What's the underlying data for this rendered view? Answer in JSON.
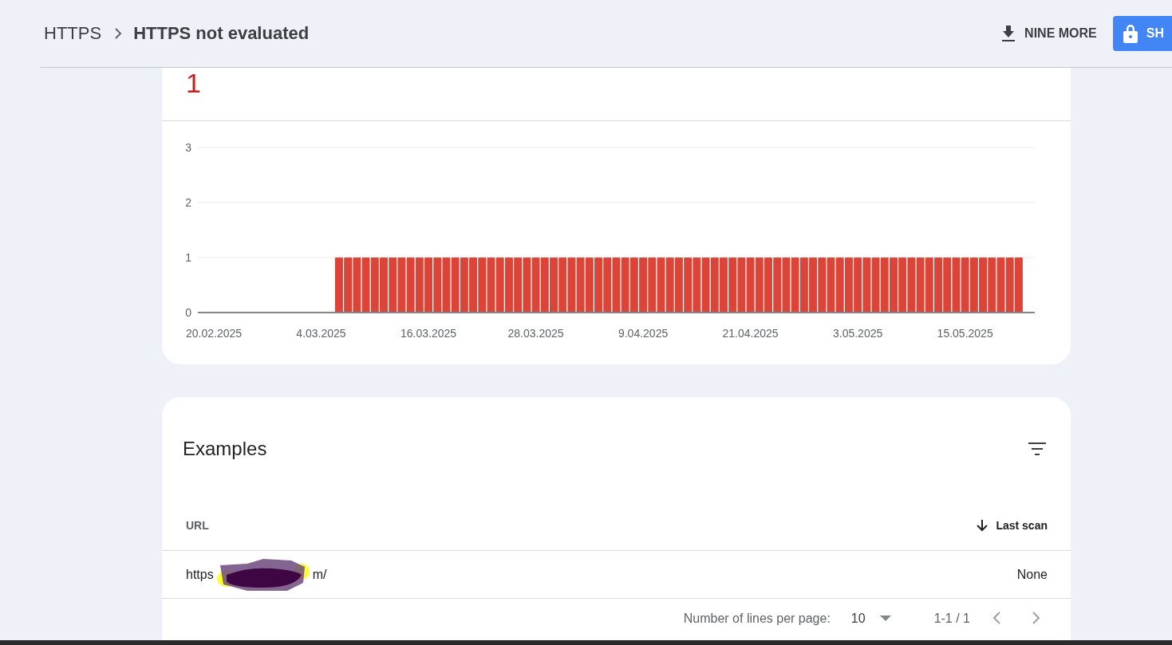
{
  "breadcrumb": {
    "parent": "HTTPS",
    "current": "HTTPS not evaluated"
  },
  "actions": [
    {
      "kind": "export",
      "label": "NINE MORE"
    },
    {
      "kind": "share",
      "label": "SH"
    }
  ],
  "summary": {
    "count": "1"
  },
  "chart_data": {
    "type": "bar",
    "categories": [
      "20.02.2025",
      null,
      null,
      null,
      null,
      null,
      null,
      null,
      null,
      null,
      null,
      null,
      "4.03.2025",
      null,
      null,
      null,
      null,
      null,
      null,
      null,
      null,
      null,
      null,
      null,
      "16.03.2025",
      null,
      null,
      null,
      null,
      null,
      null,
      null,
      null,
      null,
      null,
      null,
      "28.03.2025",
      null,
      null,
      null,
      null,
      null,
      null,
      null,
      null,
      null,
      null,
      null,
      "9.04.2025",
      null,
      null,
      null,
      null,
      null,
      null,
      null,
      null,
      null,
      null,
      null,
      "21.04.2025",
      null,
      null,
      null,
      null,
      null,
      null,
      null,
      null,
      null,
      null,
      null,
      "3.05.2025",
      null,
      null,
      null,
      null,
      null,
      null,
      null,
      null,
      null,
      null,
      null,
      "15.05.2025",
      null,
      null,
      null,
      null,
      null,
      null
    ],
    "series": [
      {
        "color": "#db4437",
        "values": [
          0,
          0,
          0,
          0,
          0,
          0,
          0,
          0,
          0,
          0,
          0,
          0,
          0,
          0,
          1,
          1,
          1,
          1,
          1,
          1,
          1,
          1,
          1,
          1,
          1,
          1,
          1,
          1,
          1,
          1,
          1,
          1,
          1,
          1,
          1,
          1,
          1,
          1,
          1,
          1,
          1,
          1,
          1,
          1,
          1,
          1,
          1,
          1,
          1,
          1,
          1,
          1,
          1,
          1,
          1,
          1,
          1,
          1,
          1,
          1,
          1,
          1,
          1,
          1,
          1,
          1,
          1,
          1,
          1,
          1,
          1,
          1,
          1,
          1,
          1,
          1,
          1,
          1,
          1,
          1,
          1,
          1,
          1,
          1,
          1,
          1,
          1,
          1,
          1,
          1,
          1
        ]
      }
    ],
    "ylim": [
      0,
      3
    ],
    "yticks": [
      0,
      1,
      2,
      3
    ]
  },
  "examples": {
    "title": "Examples",
    "columns": [
      {
        "label": "URL",
        "sorted": false
      },
      {
        "label": "Last scan",
        "sorted": true
      }
    ],
    "rows": [
      {
        "url_parts": [
          "https",
          "m/"
        ],
        "redacted": true,
        "last_scan": "None"
      }
    ],
    "pagination": {
      "rows_label": "Number of lines per page:",
      "rows_per_page": "10",
      "range": "1-1 / 1"
    }
  }
}
